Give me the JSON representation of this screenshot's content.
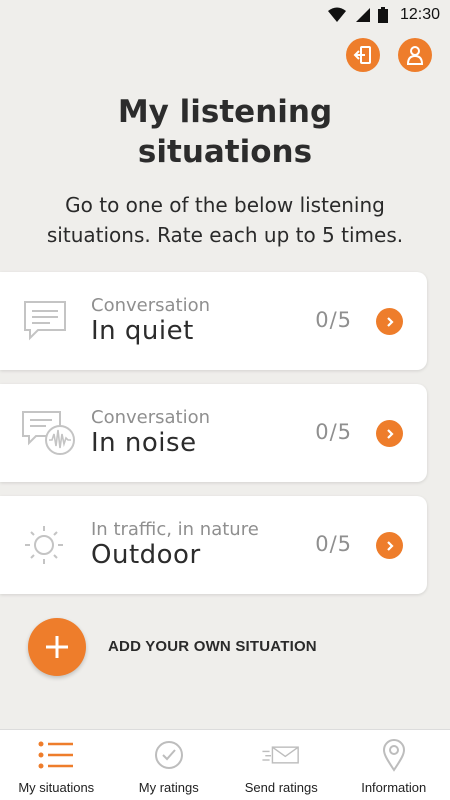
{
  "status_bar": {
    "time": "12:30"
  },
  "header": {
    "title": "My listening situations",
    "subtitle": "Go to one of the below listening situations. Rate each up to 5 times."
  },
  "situations": [
    {
      "category": "Conversation",
      "name": "In quiet",
      "count": "0/5",
      "icon": "speech-bubble-icon"
    },
    {
      "category": "Conversation",
      "name": "In noise",
      "count": "0/5",
      "icon": "speech-noise-icon"
    },
    {
      "category": "In traffic, in nature",
      "name": "Outdoor",
      "count": "0/5",
      "icon": "sun-icon"
    }
  ],
  "add_situation": {
    "label": "ADD YOUR OWN SITUATION"
  },
  "nav": {
    "items": [
      {
        "label": "My situations",
        "icon": "list-icon",
        "active": true
      },
      {
        "label": "My ratings",
        "icon": "check-circle-icon",
        "active": false
      },
      {
        "label": "Send ratings",
        "icon": "send-mail-icon",
        "active": false
      },
      {
        "label": "Information",
        "icon": "location-pin-icon",
        "active": false
      }
    ]
  },
  "colors": {
    "accent": "#ee7d2b",
    "background": "#efeeeb",
    "card": "#ffffff",
    "muted": "#8f8f8f"
  }
}
